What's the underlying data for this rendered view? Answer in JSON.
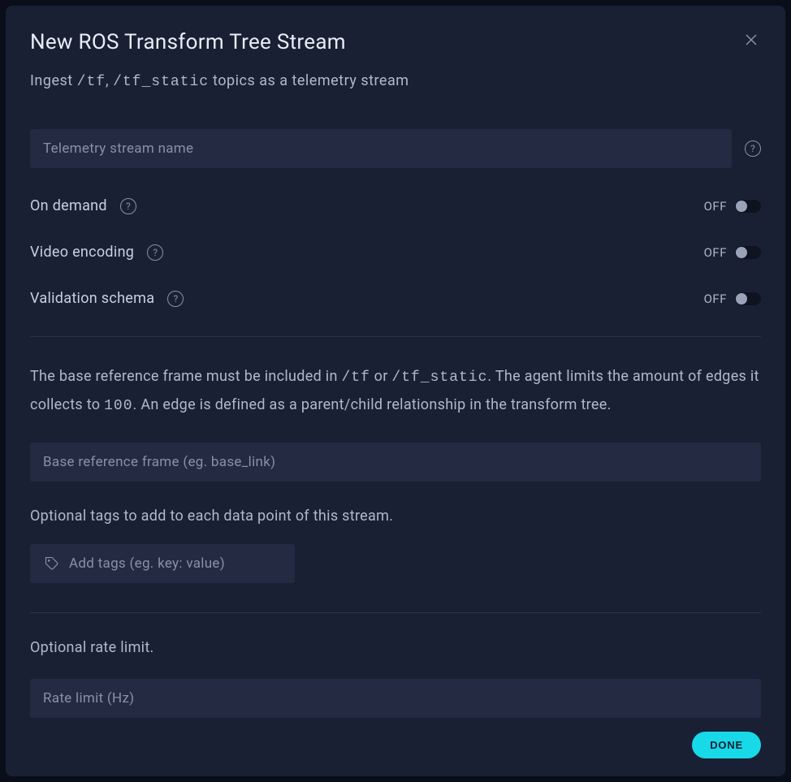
{
  "modal": {
    "title": "New ROS Transform Tree Stream",
    "subtitle_prefix": "Ingest ",
    "subtitle_code1": "/tf",
    "subtitle_sep": ", ",
    "subtitle_code2": "/tf_static",
    "subtitle_suffix": " topics as a telemetry stream",
    "stream_name_placeholder": "Telemetry stream name",
    "toggles": {
      "on_demand": {
        "label": "On demand",
        "state": "OFF"
      },
      "video_encoding": {
        "label": "Video encoding",
        "state": "OFF"
      },
      "validation_schema": {
        "label": "Validation schema",
        "state": "OFF"
      }
    },
    "desc_part1": "The base reference frame must be included in ",
    "desc_code1": "/tf",
    "desc_or": " or ",
    "desc_code2": "/tf_static",
    "desc_part2": ". The agent limits the amount of edges it collects to ",
    "desc_limit": "100",
    "desc_part3": ". An edge is defined as a parent/child relationship in the transform tree.",
    "base_frame_placeholder": "Base reference frame (eg. base_link)",
    "tags_label": "Optional tags to add to each data point of this stream.",
    "tags_placeholder": "Add tags (eg. key: value)",
    "rate_limit_label": "Optional rate limit.",
    "rate_limit_placeholder": "Rate limit (Hz)",
    "done_label": "DONE"
  }
}
